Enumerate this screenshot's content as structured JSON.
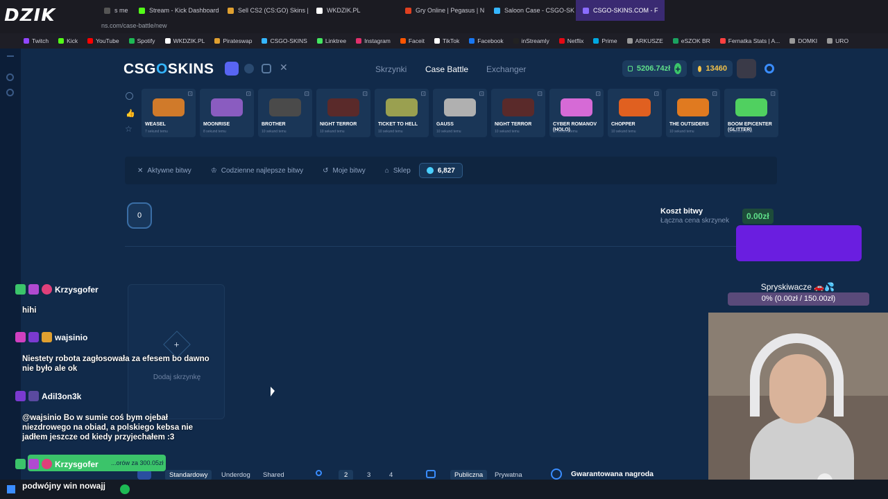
{
  "stream_logo": "DZIK",
  "browser": {
    "tabs": [
      {
        "label": "s me",
        "color": "#555"
      },
      {
        "label": "Stream - Kick Dashboard",
        "color": "#53fc18"
      },
      {
        "label": "Sell CS2 (CS:GO) Skins |",
        "color": "#e0a030"
      },
      {
        "label": "WKDZIK.PL",
        "color": "#ffffff"
      },
      {
        "label": "Gry Online | Pegasus | N",
        "color": "#e04020"
      },
      {
        "label": "Saloon Case - CSGO-SK",
        "color": "#35b6ff"
      },
      {
        "label": "CSGO-SKINS.COM - F",
        "color": "#8a6cff",
        "active": true
      }
    ],
    "url": "ns.com/case-battle/new",
    "bookmarks": [
      {
        "label": "Twitch",
        "color": "#9146ff"
      },
      {
        "label": "Kick",
        "color": "#53fc18"
      },
      {
        "label": "YouTube",
        "color": "#ff0000"
      },
      {
        "label": "Spotify",
        "color": "#1db954"
      },
      {
        "label": "WKDZIK.PL",
        "color": "#ffffff"
      },
      {
        "label": "Pirateswap",
        "color": "#e0a030"
      },
      {
        "label": "CSGO-SKINS",
        "color": "#35b6ff"
      },
      {
        "label": "Linktree",
        "color": "#43e660"
      },
      {
        "label": "Instagram",
        "color": "#e1306c"
      },
      {
        "label": "Faceit",
        "color": "#ff5500"
      },
      {
        "label": "TikTok",
        "color": "#ffffff"
      },
      {
        "label": "Facebook",
        "color": "#1877f2"
      },
      {
        "label": "inStreamly",
        "color": "#222"
      },
      {
        "label": "Netflix",
        "color": "#e50914"
      },
      {
        "label": "Prime",
        "color": "#00a8e1"
      },
      {
        "label": "ARKUSZE",
        "color": "#999"
      },
      {
        "label": "eSZOK BR",
        "color": "#1aa260"
      },
      {
        "label": "Fernatka Stats | A...",
        "color": "#ff4040"
      },
      {
        "label": "DOMKI",
        "color": "#999"
      },
      {
        "label": "URO",
        "color": "#999"
      }
    ]
  },
  "site": {
    "brand_left": "CSG",
    "brand_o": "O",
    "brand_right": "SKINS",
    "nav": [
      "Skrzynki",
      "Case Battle",
      "Exchanger"
    ],
    "balance": "5206.74zł",
    "coins": "13460",
    "cases": [
      {
        "name": "WEASEL",
        "sub": "7 sekund temu",
        "color": "#d07a2a"
      },
      {
        "name": "MOONRISE",
        "sub": "8 sekund temu",
        "color": "#8a5cc0"
      },
      {
        "name": "BROTHER",
        "sub": "10 sekund temu",
        "color": "#4a4a4a"
      },
      {
        "name": "NIGHT TERROR",
        "sub": "10 sekund temu",
        "color": "#5a2a2a"
      },
      {
        "name": "TICKET TO HELL",
        "sub": "10 sekund temu",
        "color": "#9aa050"
      },
      {
        "name": "GAUSS",
        "sub": "10 sekund temu",
        "color": "#b0b0b0"
      },
      {
        "name": "NIGHT TERROR",
        "sub": "10 sekund temu",
        "color": "#5a2a2a"
      },
      {
        "name": "CYBER ROMANOV (HOLO)",
        "sub": "10 sekund temu",
        "color": "#d66ad6"
      },
      {
        "name": "CHOPPER",
        "sub": "10 sekund temu",
        "color": "#e06020"
      },
      {
        "name": "THE OUTSIDERS",
        "sub": "10 sekund temu",
        "color": "#e07a20"
      },
      {
        "name": "BOOM EPICENTER (GLITTER)",
        "sub": "10 sekund temu",
        "color": "#50d060"
      }
    ],
    "battle_tabs": [
      "Aktywne bitwy",
      "Codzienne najlepsze bitwy",
      "Moje bitwy",
      "Sklep"
    ],
    "gems": "6,827",
    "case_count": "0",
    "cost_title": "Koszt bitwy",
    "cost_sub": "Łączna cena skrzynek",
    "cost_value": "0.00zł",
    "add_case_label": "Dodaj skrzynkę",
    "goal_title": "Spryskiwacze 🚗💦",
    "goal_value": "0% (0.00zł / 150.00zł)",
    "modes": [
      "Standardowy",
      "Underdog",
      "Shared"
    ],
    "players": [
      "2",
      "3",
      "4"
    ],
    "visibility": [
      "Publiczna",
      "Prywatna"
    ],
    "guarantee": "Gwarantowana nagroda",
    "create_label": "...orów za 300.05zł"
  },
  "chat": [
    {
      "user": "Krzysgofer",
      "msg": "hihi"
    },
    {
      "user": "wajsinio",
      "msg": "Niestety robota zagłosowała za efesem bo dawno nie było ale ok"
    },
    {
      "user": "Adil3on3k",
      "msg": "@wajsinio Bo w sumie coś bym ojebał niezdrowego na obiad, a polskiego kebsa nie jadłem jeszcze od kiedy przyjechałem :3"
    },
    {
      "user": "Krzysgofer",
      "msg": "podwójny win nowajj"
    }
  ]
}
